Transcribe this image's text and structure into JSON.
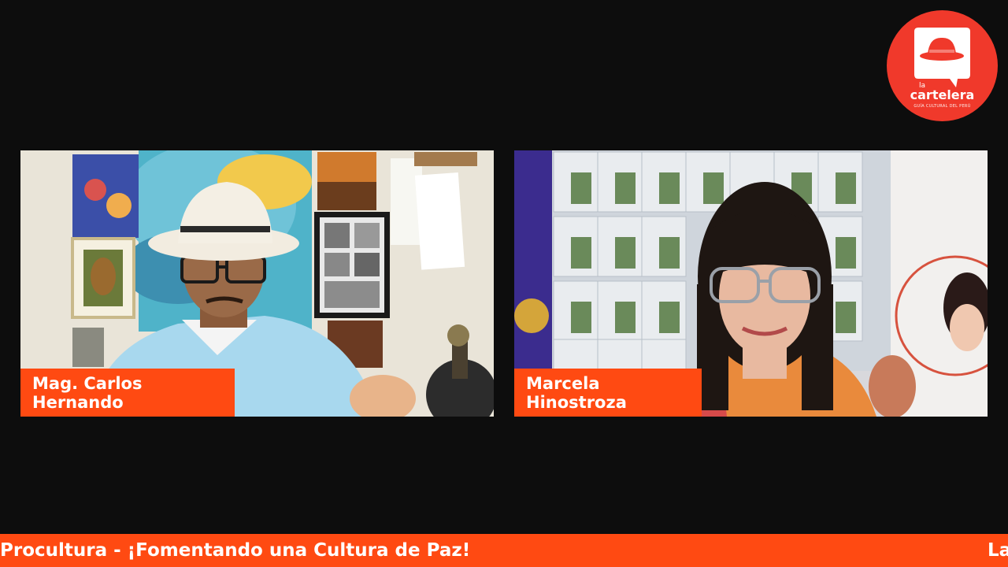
{
  "colors": {
    "background": "#0d0d0d",
    "accent": "#ff4a12",
    "logo_red": "#f0392b"
  },
  "participants": [
    {
      "name": "Mag. Carlos Hernando"
    },
    {
      "name": "Marcela Hinostroza"
    }
  ],
  "logo": {
    "small_text": "la",
    "main_text": "cartelera",
    "tagline": "GUÍA CULTURAL DEL PERÚ",
    "icon": "hat-speech-bubble-icon"
  },
  "ticker": {
    "text": "Procultura - ¡Fomentando una Cultura de Paz!",
    "next_text": "La"
  }
}
